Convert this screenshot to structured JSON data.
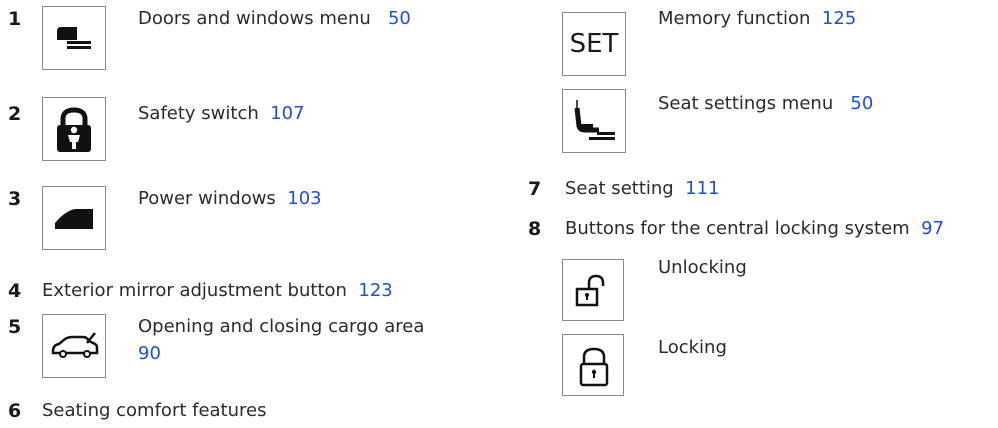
{
  "items": [
    {
      "num": "1",
      "label": "Doors and windows menu",
      "page": "50",
      "icon": "door-window-icon"
    },
    {
      "num": "2",
      "label": "Safety switch",
      "page": "107",
      "icon": "child-lock-icon"
    },
    {
      "num": "3",
      "label": "Power windows",
      "page": "103",
      "icon": "window-icon"
    },
    {
      "num": "4",
      "label": "Exterior mirror adjustment button",
      "page": "123"
    },
    {
      "num": "5",
      "label": "Opening and closing cargo area",
      "page": "90",
      "icon": "car-trunk-icon"
    },
    {
      "num": "6",
      "label": "Seating comfort features"
    },
    {
      "label": "Memory function",
      "page": "125",
      "icon": "set-icon",
      "icon_text": "SET"
    },
    {
      "label": "Seat settings menu",
      "page": "50",
      "icon": "seat-settings-icon"
    },
    {
      "num": "7",
      "label": "Seat setting",
      "page": "111"
    },
    {
      "num": "8",
      "label": "Buttons for the central locking system",
      "page": "97"
    },
    {
      "label": "Unlocking",
      "icon": "unlock-icon"
    },
    {
      "label": "Locking",
      "icon": "lock-icon"
    }
  ],
  "colors": {
    "link": "#1f4fd9",
    "text": "#2b2b2b",
    "border": "#8a8a8a"
  }
}
